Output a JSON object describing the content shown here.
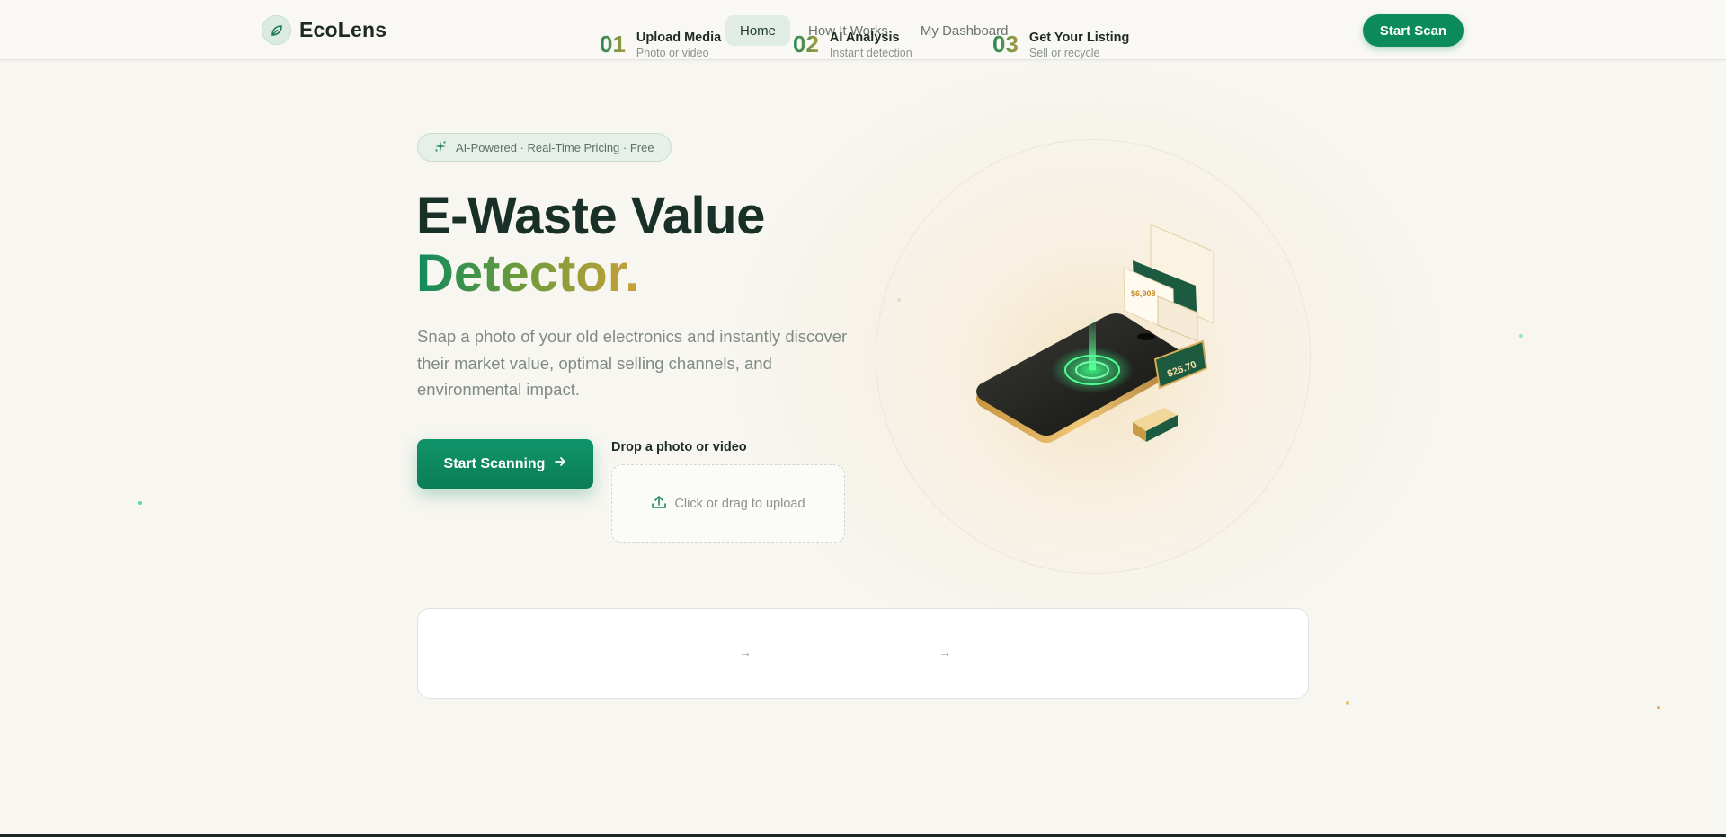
{
  "colors": {
    "accent": "#0b8a5c",
    "gold": "#c9a13a",
    "text_dark": "#193028"
  },
  "brand": {
    "name": "EcoLens",
    "logo_icon": "leaf-icon"
  },
  "nav": {
    "links": [
      {
        "label": "Home",
        "active": true
      },
      {
        "label": "How It Works",
        "active": false
      },
      {
        "label": "My Dashboard",
        "active": false
      }
    ],
    "cta_label": "Start Scan"
  },
  "hero": {
    "badge": "AI-Powered · Real-Time Pricing · Free",
    "badge_icon": "sparkle-icon",
    "title_line1": "E-Waste Value",
    "title_line2": "Detector.",
    "subtitle": "Snap a photo of your old electronics and instantly discover their market value, optimal selling channels, and environmental impact.",
    "primary_button": "Start Scanning",
    "primary_button_icon": "arrow-right-icon",
    "drop_label": "Drop a photo or video",
    "drop_text": "Click or drag to upload",
    "drop_icon": "upload-icon"
  },
  "illustration": {
    "price_tag_1": "$26.70",
    "price_tag_2": "$6,908"
  },
  "steps": [
    {
      "num": "01",
      "title": "Upload Media",
      "sub": "Photo or video"
    },
    {
      "num": "02",
      "title": "AI Analysis",
      "sub": "Instant detection"
    },
    {
      "num": "03",
      "title": "Get Your Listing",
      "sub": "Sell or recycle"
    }
  ]
}
